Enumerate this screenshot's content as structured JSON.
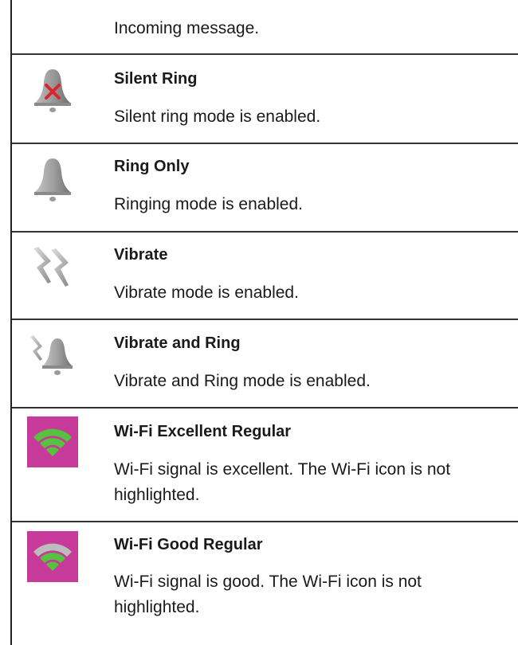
{
  "rows": [
    {
      "title": "",
      "desc": "Incoming message."
    },
    {
      "title": "Silent Ring",
      "desc": "Silent ring mode is enabled.",
      "icon": "silent-bell-icon"
    },
    {
      "title": "Ring Only",
      "desc": "Ringing mode is enabled.",
      "icon": "bell-icon"
    },
    {
      "title": "Vibrate",
      "desc": "Vibrate mode is enabled.",
      "icon": "vibrate-icon"
    },
    {
      "title": "Vibrate and Ring",
      "desc": "Vibrate and Ring mode is enabled.",
      "icon": "vibrate-ring-icon"
    },
    {
      "title": "Wi-Fi Excellent Regular",
      "desc": "Wi-Fi signal is excellent. The Wi-Fi icon is not highlighted.",
      "icon": "wifi-excellent-icon"
    },
    {
      "title": "Wi-Fi Good Regular",
      "desc": "Wi-Fi signal is good. The Wi-Fi icon is not highlighted.",
      "icon": "wifi-good-icon"
    }
  ],
  "colors": {
    "wifi_bg": "#c73a9a",
    "wifi_green": "#56c23f",
    "bell_gray": "#8d8d8d",
    "cross_red": "#d8262c"
  }
}
